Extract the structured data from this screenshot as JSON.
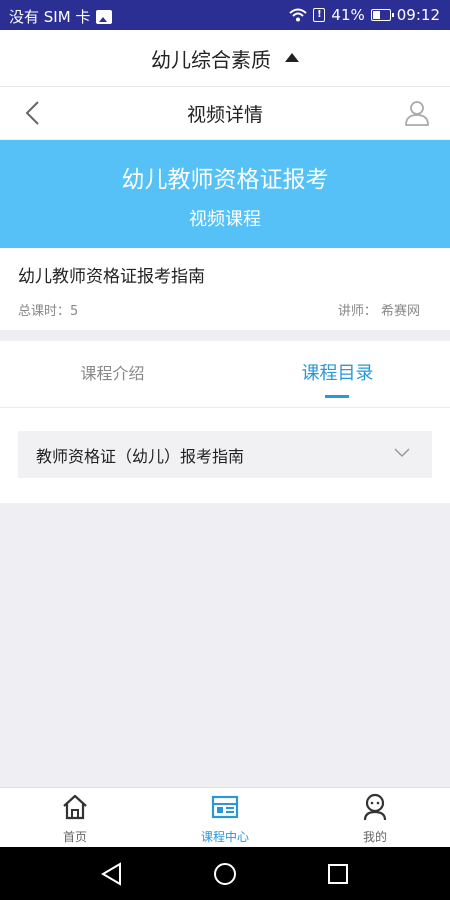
{
  "status_bar": {
    "carrier": "没有 SIM 卡",
    "battery": "41%",
    "time": "09:12"
  },
  "header": {
    "category": "幼儿综合素质"
  },
  "nav": {
    "title": "视频详情"
  },
  "hero": {
    "title": "幼儿教师资格证报考",
    "subtitle": "视频课程"
  },
  "course": {
    "name": "幼儿教师资格证报考指南",
    "hours": "总课时：5",
    "lecturer": "讲师：  希赛网"
  },
  "tabs": [
    {
      "label": "课程介绍",
      "active": false
    },
    {
      "label": "课程目录",
      "active": true
    }
  ],
  "catalog": {
    "items": [
      {
        "label": "教师资格证（幼儿）报考指南"
      }
    ]
  },
  "bottom_nav": [
    {
      "label": "首页",
      "icon": "home-icon",
      "active": false
    },
    {
      "label": "课程中心",
      "icon": "course-center-icon",
      "active": true
    },
    {
      "label": "我的",
      "icon": "profile-icon",
      "active": false
    }
  ],
  "colors": {
    "status_bar": "#2b2f93",
    "hero": "#55c1f6",
    "accent": "#2a98d8",
    "background": "#eeeef3"
  }
}
